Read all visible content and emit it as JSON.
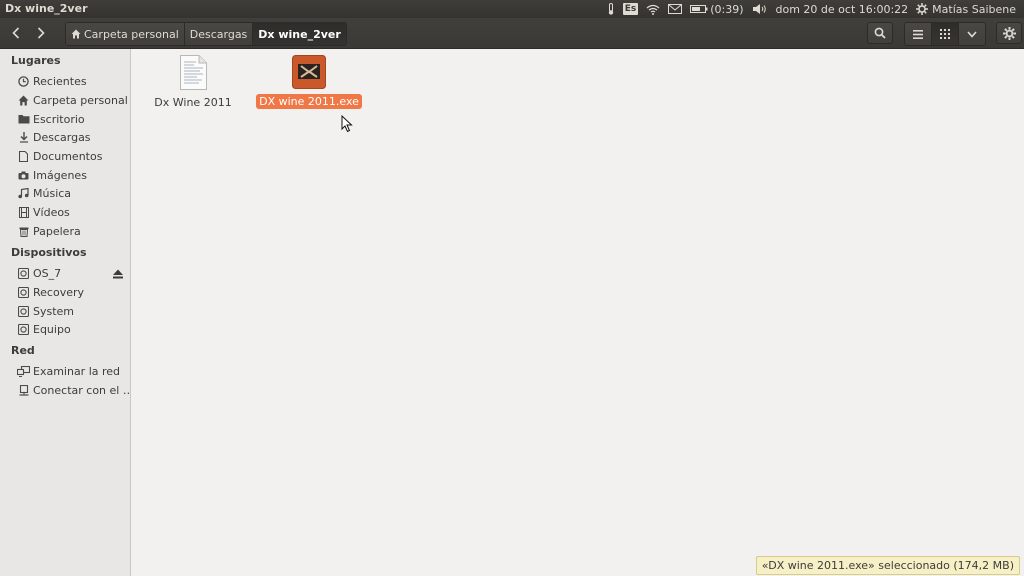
{
  "window_title": "Dx wine_2ver",
  "panel": {
    "keyboard_layout": "Es",
    "battery_text": "(0:39)",
    "datetime": "dom 20 de oct  16:00:22",
    "user": "Matías Saibene"
  },
  "breadcrumbs": [
    "Carpeta personal",
    "Descargas",
    "Dx wine_2ver"
  ],
  "sidebar": {
    "places_header": "Lugares",
    "places": [
      {
        "label": "Recientes",
        "icon": "clock-icon"
      },
      {
        "label": "Carpeta personal",
        "icon": "home-icon"
      },
      {
        "label": "Escritorio",
        "icon": "folder-icon"
      },
      {
        "label": "Descargas",
        "icon": "download-icon"
      },
      {
        "label": "Documentos",
        "icon": "document-icon"
      },
      {
        "label": "Imágenes",
        "icon": "camera-icon"
      },
      {
        "label": "Música",
        "icon": "music-icon"
      },
      {
        "label": "Vídeos",
        "icon": "film-icon"
      },
      {
        "label": "Papelera",
        "icon": "trash-icon"
      }
    ],
    "devices_header": "Dispositivos",
    "devices": [
      {
        "label": "OS_7",
        "icon": "drive-icon"
      },
      {
        "label": "Recovery",
        "icon": "drive-icon"
      },
      {
        "label": "System",
        "icon": "drive-icon"
      },
      {
        "label": "Equipo",
        "icon": "drive-icon"
      }
    ],
    "network_header": "Red",
    "network": [
      {
        "label": "Examinar la red",
        "icon": "network-icon"
      },
      {
        "label": "Conectar con el …",
        "icon": "server-icon"
      }
    ]
  },
  "files": [
    {
      "name": "Dx Wine 2011",
      "type": "text-file-icon",
      "selected": false
    },
    {
      "name": "DX wine 2011.exe",
      "type": "exe-file-icon",
      "selected": true
    }
  ],
  "status_text": "«DX wine 2011.exe» seleccionado  (174,2 MB)",
  "colors": {
    "selection": "#f07746",
    "panel": "#3c3b37",
    "exe_icon": "#c9582a"
  }
}
